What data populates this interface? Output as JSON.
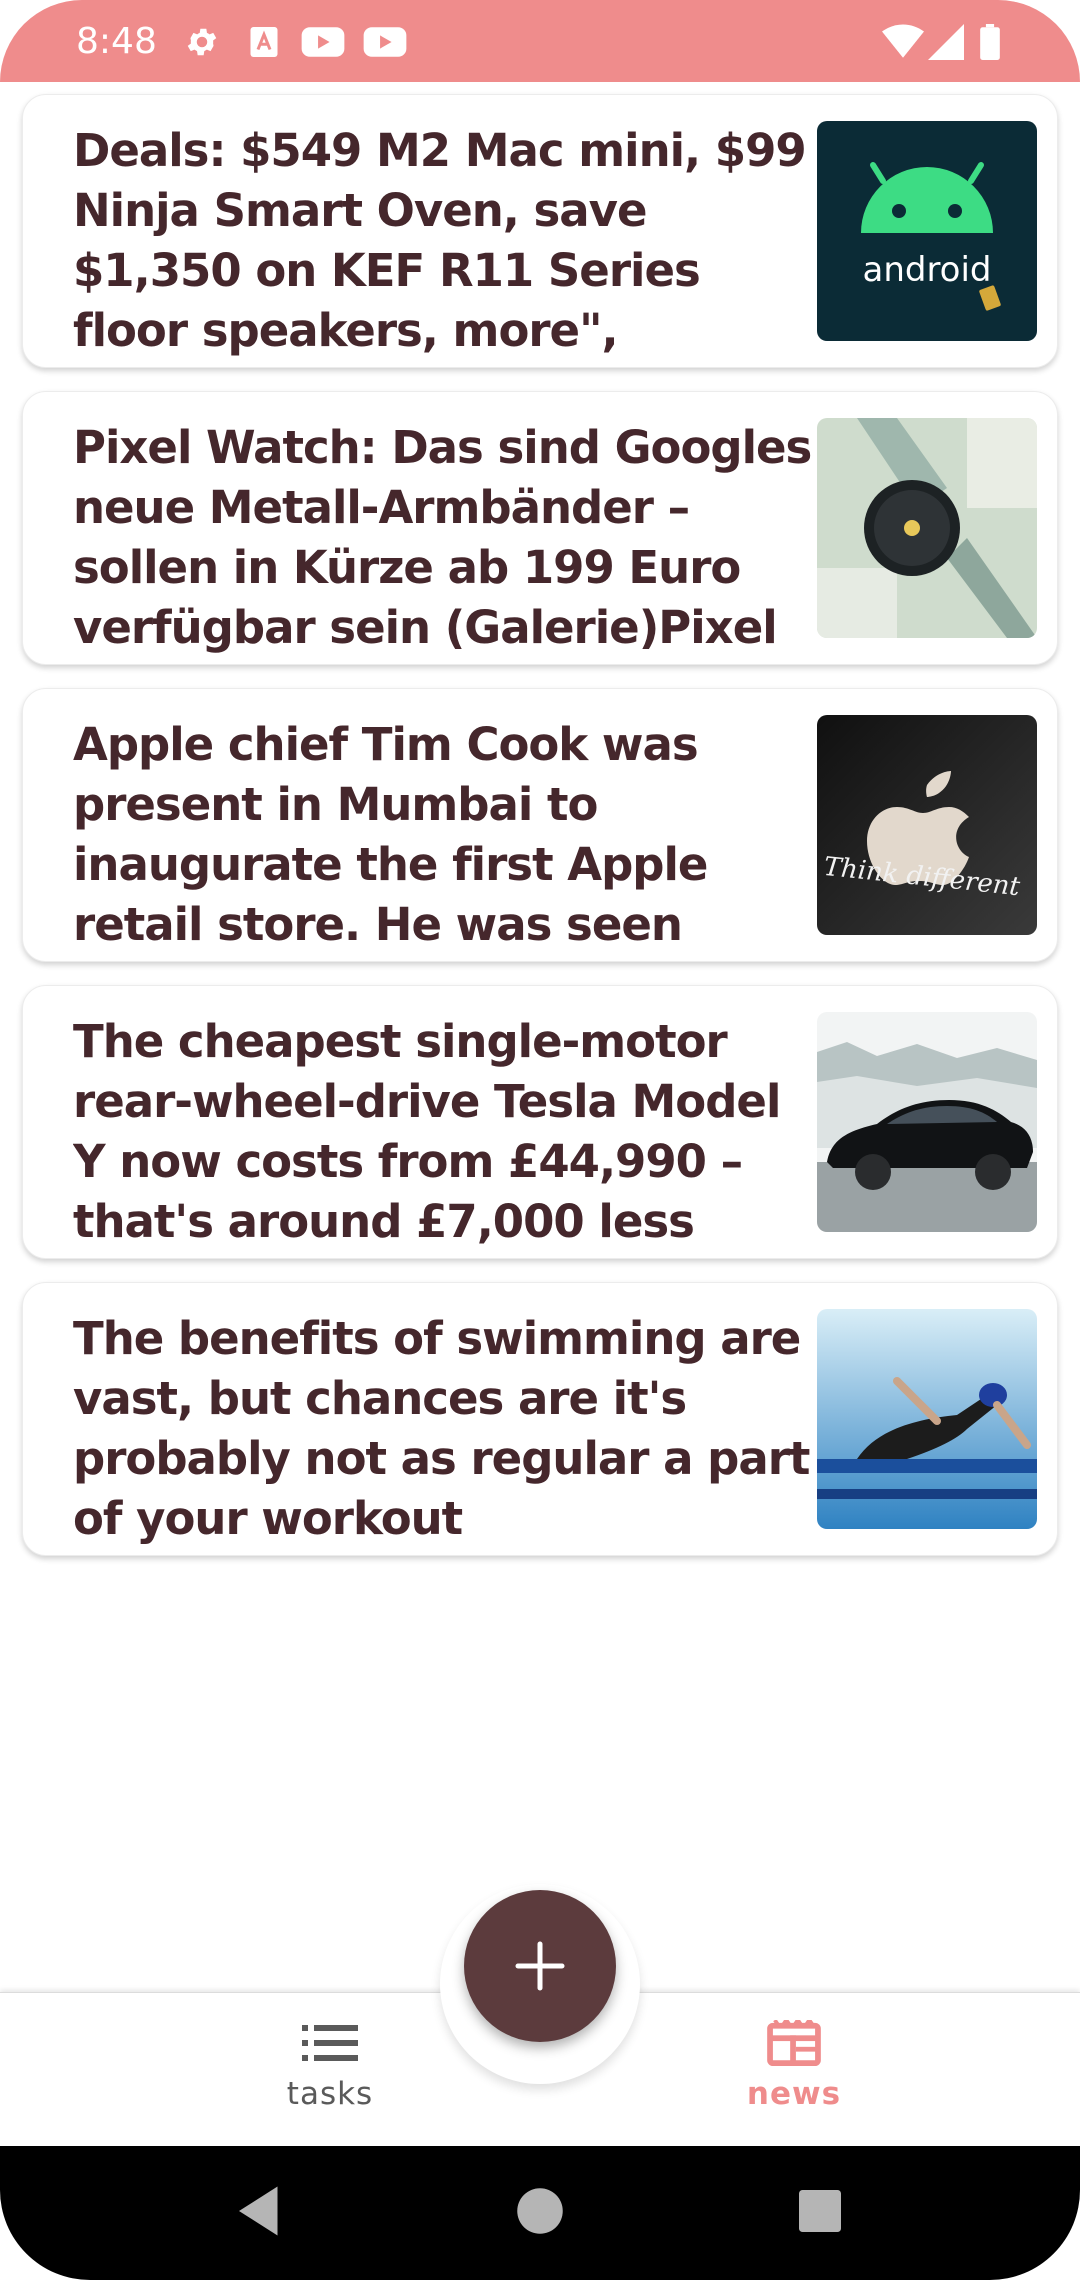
{
  "status_bar": {
    "time": "8:48",
    "background": "#ef8c8c",
    "left_icons": [
      "gear-icon",
      "text-a-icon",
      "youtube-icon",
      "youtube-icon"
    ],
    "right_icons": [
      "wifi-icon",
      "cell-signal-icon",
      "battery-icon"
    ]
  },
  "news": {
    "items": [
      {
        "title": "Deals: $549 M2 Mac mini, $99 Ninja Smart Oven, save $1,350 on KEF R11 Series floor speakers, more\",",
        "thumbnail": "android-logo-image"
      },
      {
        "title": "Pixel Watch: Das sind Googles neue Metall-Armbänder – sollen in Kürze ab 199 Euro verfügbar sein (Galerie)Pixel",
        "thumbnail": "pixel-watch-image"
      },
      {
        "title": "Apple chief Tim Cook was present in Mumbai to inaugurate the first Apple retail store. He was seen",
        "thumbnail": "apple-think-different-image"
      },
      {
        "title": "The cheapest single-motor rear-wheel-drive Tesla Model Y now costs from £44,990 – that's around £7,000 less",
        "thumbnail": "tesla-model-y-image"
      },
      {
        "title": "The benefits of swimming are vast, but chances are it's probably not as regular a part of your workout",
        "thumbnail": "swimmer-image"
      }
    ],
    "thumb_text": {
      "android": "android",
      "apple": "Think different"
    }
  },
  "fab": {
    "icon": "plus-icon",
    "color": "#5c3b3d"
  },
  "bottom_nav": {
    "tasks_label": "tasks",
    "tasks_icon": "list-icon",
    "news_label": "news",
    "news_icon": "newspaper-icon",
    "active_color": "#ef8c8c",
    "active": "news"
  },
  "system_nav": {
    "buttons": [
      "back-icon",
      "home-icon",
      "recents-icon"
    ]
  }
}
